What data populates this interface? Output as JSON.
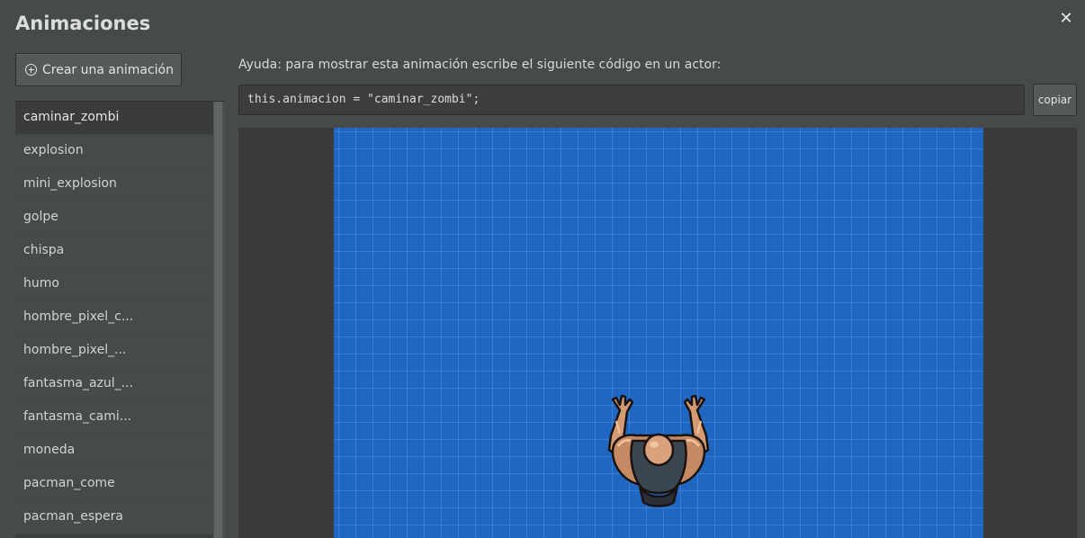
{
  "dialog": {
    "title": "Animaciones",
    "close_icon": "close-icon",
    "close_glyph": "✕"
  },
  "sidebar": {
    "create_button_label": "Crear una animación",
    "create_button_icon": "plus-circle-icon",
    "items": [
      {
        "label": "caminar_zombi",
        "selected": true
      },
      {
        "label": "explosion"
      },
      {
        "label": "mini_explosion"
      },
      {
        "label": "golpe"
      },
      {
        "label": "chispa"
      },
      {
        "label": "humo"
      },
      {
        "label": "hombre_pixel_c..."
      },
      {
        "label": "hombre_pixel_..."
      },
      {
        "label": "fantasma_azul_..."
      },
      {
        "label": "fantasma_cami..."
      },
      {
        "label": "moneda"
      },
      {
        "label": "pacman_come"
      },
      {
        "label": "pacman_espera"
      }
    ]
  },
  "main": {
    "help_text": "Ayuda: para mostrar esta animación escribe el siguiente código en un actor:",
    "code": "this.animacion = \"caminar_zombi\";",
    "copy_button_label": "copiar"
  },
  "preview": {
    "canvas_color": "#2067c4",
    "sprite_icon": "zombie-top-down-sprite-icon"
  }
}
